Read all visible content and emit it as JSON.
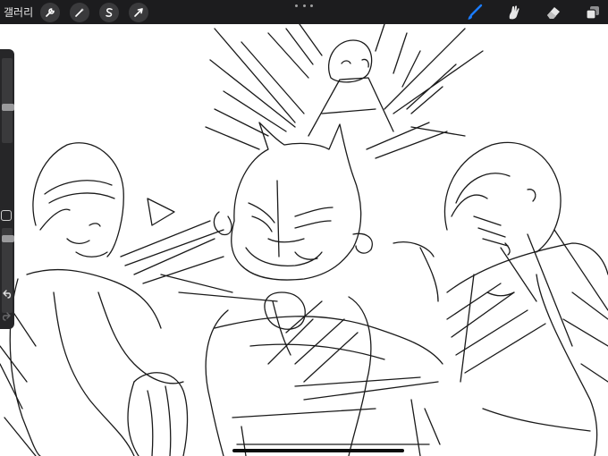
{
  "topbar": {
    "gallery_label": "갤러리",
    "tools_left": [
      {
        "icon": "wrench-icon"
      },
      {
        "icon": "magic-wand-icon"
      },
      {
        "icon": "selection-s-icon"
      },
      {
        "icon": "transform-arrow-icon"
      }
    ],
    "tools_right": [
      {
        "icon": "brush-icon",
        "active": true
      },
      {
        "icon": "smudge-icon"
      },
      {
        "icon": "eraser-icon"
      },
      {
        "icon": "layers-icon"
      }
    ],
    "colors": {
      "bar": "#1c1c1e",
      "active_tool": "#1a7cff"
    }
  },
  "sidebar": {
    "brush_size_level": 0.45,
    "opacity_level": 0.35,
    "modify_button": "square-icon",
    "undo": "undo-icon",
    "redo": "redo-icon"
  }
}
